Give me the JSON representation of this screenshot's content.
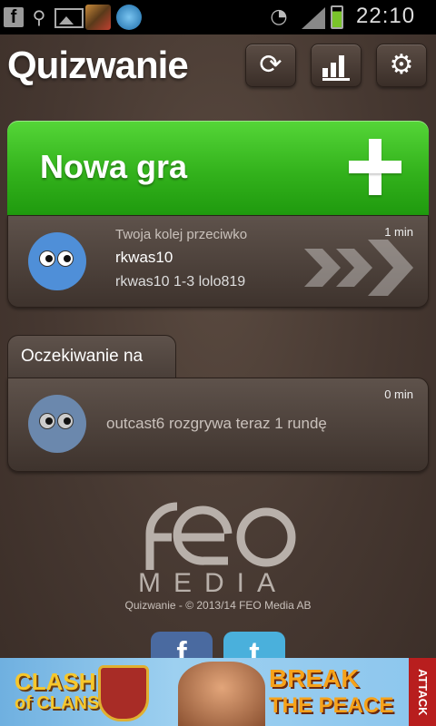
{
  "status_bar": {
    "time": "22:10",
    "icons": [
      "facebook-icon",
      "usb-icon",
      "gallery-icon",
      "app-icon",
      "app-icon",
      "wifi-icon",
      "signal-icon",
      "battery-charging-icon"
    ]
  },
  "header": {
    "title": "Quizwanie",
    "buttons": [
      "refresh-icon",
      "stats-icon",
      "settings-icon"
    ]
  },
  "new_game": {
    "label": "Nowa gra"
  },
  "your_turn_game": {
    "caption": "Twoja kolej przeciwko",
    "opponent": "rkwas10",
    "score": "rkwas10 1-3 lolo819",
    "time": "1 min"
  },
  "waiting_section": {
    "tab_label": "Oczekiwanie na",
    "game": {
      "text": "outcast6 rozgrywa teraz 1 rundę",
      "time": "0 min"
    }
  },
  "footer": {
    "logo_top": "FEO",
    "logo_bottom": "MEDIA",
    "copyright": "Quizwanie - © 2013/14  FEO Media AB",
    "social": [
      "f",
      "t"
    ]
  },
  "ad": {
    "left_text_1": "CLASH",
    "left_text_2": "of CLANS",
    "headline_1": "BREAK",
    "headline_2": "THE PEACE",
    "side_label": "ATTACK"
  },
  "colors": {
    "accent_green": "#33b21c",
    "background": "#463831",
    "avatar_blue": "#4f8fd8"
  }
}
